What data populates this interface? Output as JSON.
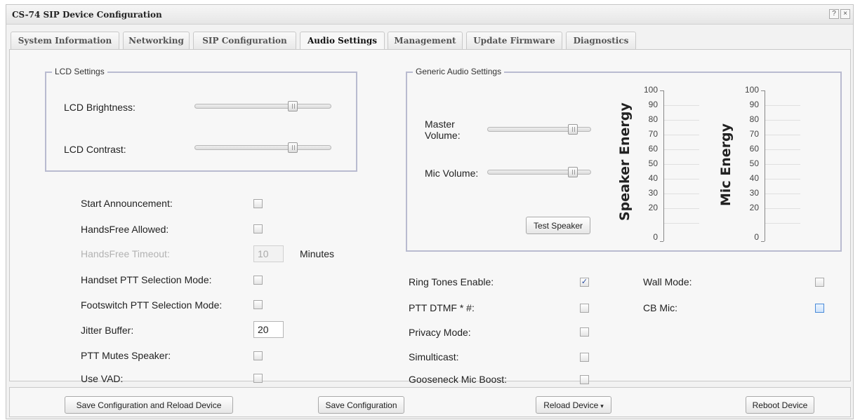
{
  "window": {
    "title": "CS-74 SIP Device Configuration",
    "help_icon": "?",
    "close_icon": "×"
  },
  "tabs": [
    {
      "label": "System Information"
    },
    {
      "label": "Networking"
    },
    {
      "label": "SIP Configuration"
    },
    {
      "label": "Audio Settings",
      "active": true
    },
    {
      "label": "Management"
    },
    {
      "label": "Update Firmware"
    },
    {
      "label": "Diagnostics"
    }
  ],
  "lcd": {
    "legend": "LCD Settings",
    "brightness_label": "LCD Brightness:",
    "brightness_value": 0.72,
    "contrast_label": "LCD Contrast:",
    "contrast_value": 0.72
  },
  "generic_audio": {
    "legend": "Generic Audio Settings",
    "master_volume_label_1": "Master",
    "master_volume_label_2": "Volume:",
    "master_volume_value": 0.82,
    "mic_volume_label": "Mic Volume:",
    "mic_volume_value": 0.82,
    "test_speaker_label": "Test Speaker",
    "speaker_energy": {
      "title": "Speaker Energy",
      "ticks": [
        "100",
        "90",
        "80",
        "70",
        "60",
        "50",
        "40",
        "30",
        "20",
        "0"
      ]
    },
    "mic_energy": {
      "title": "Mic Energy",
      "ticks": [
        "100",
        "90",
        "80",
        "70",
        "60",
        "50",
        "40",
        "30",
        "20",
        "0"
      ]
    }
  },
  "left_settings": {
    "start_announcement": {
      "label": "Start Announcement:",
      "checked": false
    },
    "handsfree_allowed": {
      "label": "HandsFree Allowed:",
      "checked": false
    },
    "handsfree_timeout": {
      "label": "HandsFree Timeout:",
      "value": "10",
      "unit": "Minutes"
    },
    "handset_ptt": {
      "label": "Handset PTT Selection Mode:",
      "checked": false
    },
    "footswitch_ptt": {
      "label": "Footswitch PTT Selection Mode:",
      "checked": false
    },
    "jitter_buffer": {
      "label": "Jitter Buffer:",
      "value": "20"
    },
    "ptt_mutes_speaker": {
      "label": "PTT Mutes Speaker:",
      "checked": false
    },
    "use_vad": {
      "label": "Use VAD:",
      "checked": false
    }
  },
  "middle_settings": {
    "ring_tones_enable": {
      "label": "Ring Tones Enable:",
      "checked": true,
      "check_glyph": "✓"
    },
    "ptt_dtmf": {
      "label": "PTT DTMF * #:",
      "checked": false
    },
    "privacy_mode": {
      "label": "Privacy Mode:",
      "checked": false
    },
    "simulticast": {
      "label": "Simulticast:",
      "checked": false
    },
    "gooseneck_mic_boost": {
      "label": "Gooseneck Mic Boost:",
      "checked": false
    }
  },
  "right_settings": {
    "wall_mode": {
      "label": "Wall Mode:",
      "checked": false
    },
    "cb_mic": {
      "label": "CB Mic:",
      "checked": false
    }
  },
  "footer": {
    "save_reload_label": "Save Configuration and Reload Device",
    "save_label": "Save Configuration",
    "reload_label": "Reload Device",
    "reload_caret": "▾",
    "reboot_label": "Reboot Device"
  }
}
